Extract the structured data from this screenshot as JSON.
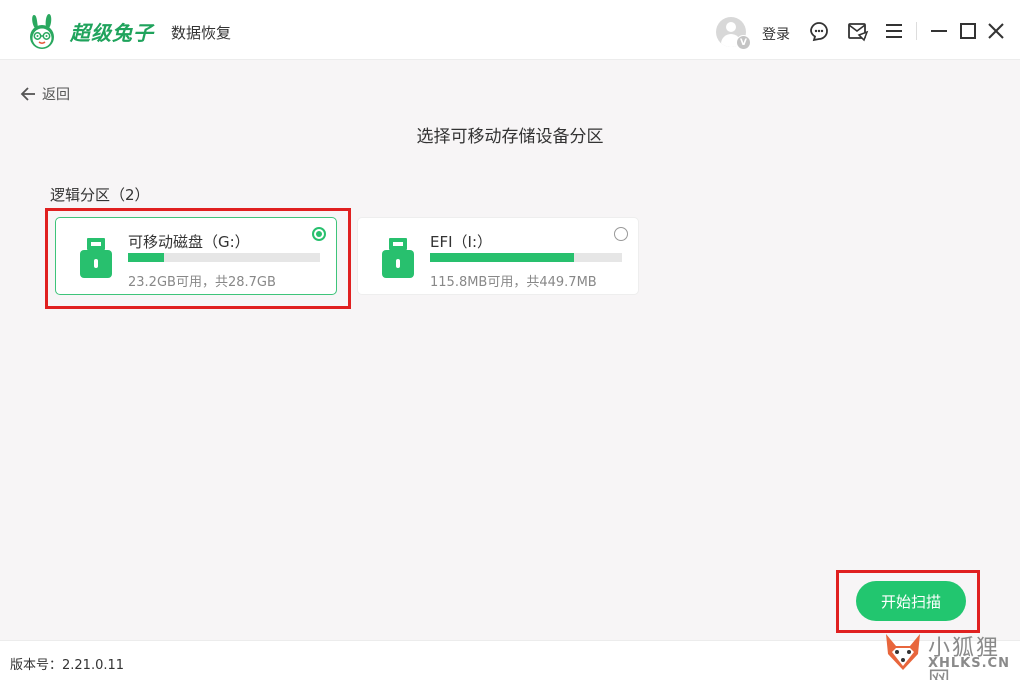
{
  "header": {
    "brand": "超级兔子",
    "product": "数据恢复",
    "avatar_badge": "V",
    "login_label": "登录",
    "icons": [
      "support-icon",
      "message-icon",
      "menu-icon",
      "minimize-icon",
      "maximize-icon",
      "close-icon"
    ]
  },
  "nav": {
    "back_label": "返回"
  },
  "main": {
    "title": "选择可移动存储设备分区",
    "section_label": "逻辑分区（2）",
    "partitions": [
      {
        "name": "可移动磁盘（G:）",
        "size_text": "23.2GB可用，共28.7GB",
        "used_fraction": 0.19,
        "selected": true
      },
      {
        "name": "EFI（I:）",
        "size_text": "115.8MB可用，共449.7MB",
        "used_fraction": 0.75,
        "selected": false
      }
    ],
    "scan_button": "开始扫描"
  },
  "footer": {
    "version": "版本号：2.21.0.11"
  },
  "watermark": {
    "line1": "小狐狸网",
    "line2": "XHLKS.CN"
  },
  "colors": {
    "accent": "#22c66f",
    "highlight": "#e02020",
    "brand": "#1fa35c"
  }
}
